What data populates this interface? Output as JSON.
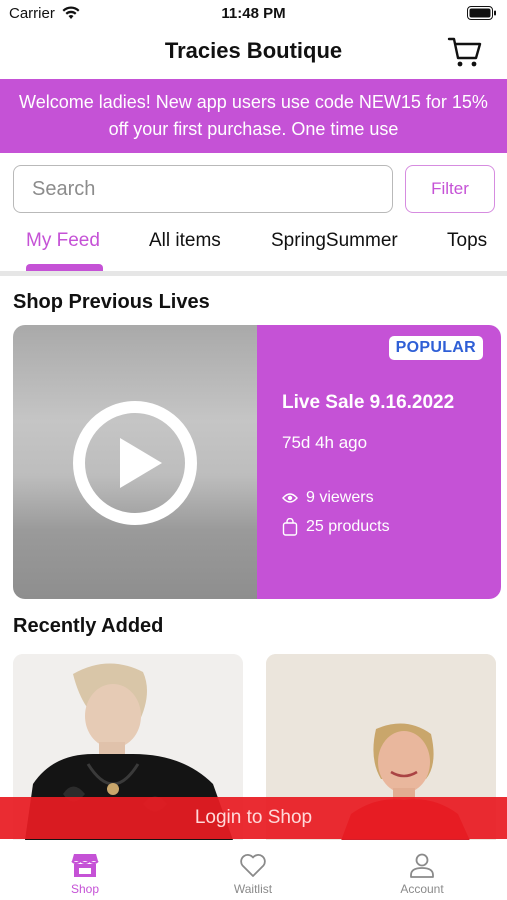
{
  "status_bar": {
    "carrier": "Carrier",
    "time": "11:48 PM"
  },
  "header": {
    "title": "Tracies Boutique"
  },
  "promo": {
    "text": "Welcome ladies! New app users use code NEW15 for 15% off your first purchase. One time use"
  },
  "search": {
    "placeholder": "Search",
    "value": ""
  },
  "filter": {
    "label": "Filter"
  },
  "tabs": [
    {
      "label": "My Feed",
      "active": true
    },
    {
      "label": "All items",
      "active": false
    },
    {
      "label": "SpringSummer",
      "active": false
    },
    {
      "label": "Tops",
      "active": false
    }
  ],
  "previous_lives": {
    "title": "Shop Previous Lives",
    "card": {
      "badge": "POPULAR",
      "title": "Live Sale 9.16.2022",
      "ago": "75d 4h ago",
      "viewers": "9 viewers",
      "products": "25 products"
    }
  },
  "recently_added": {
    "title": "Recently Added"
  },
  "login": {
    "label": "Login to Shop"
  },
  "bottom_nav": [
    {
      "label": "Shop",
      "icon": "store-icon",
      "active": true
    },
    {
      "label": "Waitlist",
      "icon": "heart-icon",
      "active": false
    },
    {
      "label": "Account",
      "icon": "person-icon",
      "active": false
    }
  ],
  "colors": {
    "accent": "#c552d6",
    "login_bar": "#e81c22",
    "badge_text": "#2f5fd6"
  }
}
